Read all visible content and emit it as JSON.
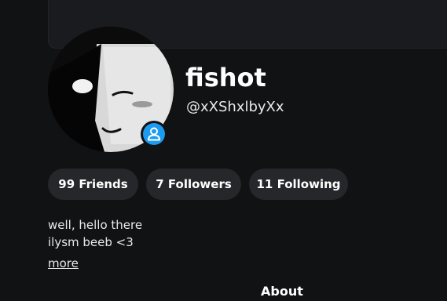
{
  "profile": {
    "display_name": "fishot",
    "username": "@xXShxlbyXx",
    "avatar_icon": "avatar-image",
    "status_icon": "user-icon",
    "status_color": "#1d9bf0"
  },
  "stats": {
    "friends_label": "99 Friends",
    "followers_label": "7 Followers",
    "following_label": "11 Following"
  },
  "bio": {
    "line1": "well, hello there",
    "line2": "ilysm beeb <3",
    "more_label": "more"
  },
  "sections": {
    "about_label": "About"
  }
}
